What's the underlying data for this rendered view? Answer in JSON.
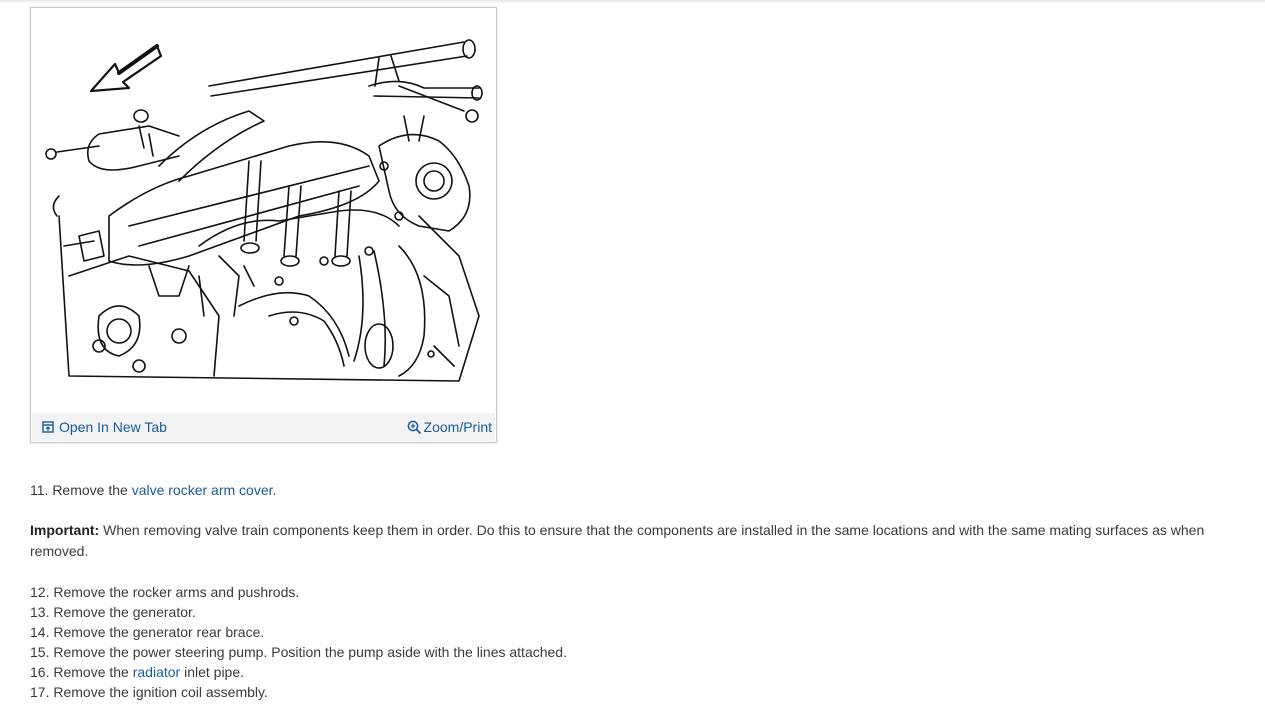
{
  "figure": {
    "open_new_tab_label": "Open In New Tab",
    "zoom_print_label": "Zoom/Print"
  },
  "steps": {
    "s11": {
      "prefix": "11. Remove the ",
      "link": "valve rocker arm cover",
      "suffix": "."
    },
    "important": {
      "label": "Important:",
      "text": " When removing valve train components keep them in order. Do this to ensure that the components are installed in the same locations and with the same mating surfaces as when removed."
    },
    "s12": "12. Remove the rocker arms and pushrods.",
    "s13": "13. Remove the generator.",
    "s14": "14. Remove the generator rear brace.",
    "s15": "15. Remove the power steering pump. Position the pump aside with the lines attached.",
    "s16": {
      "prefix": "16. Remove the ",
      "link": "radiator",
      "suffix": " inlet pipe."
    },
    "s17": "17. Remove the ignition coil assembly."
  },
  "colors": {
    "link": "#1c5a99",
    "text": "#3a3a3a",
    "bar_bg": "#f2f2f4"
  },
  "icons": {
    "open_new_tab": "open-new-tab-icon",
    "zoom": "magnifier-plus-icon"
  }
}
